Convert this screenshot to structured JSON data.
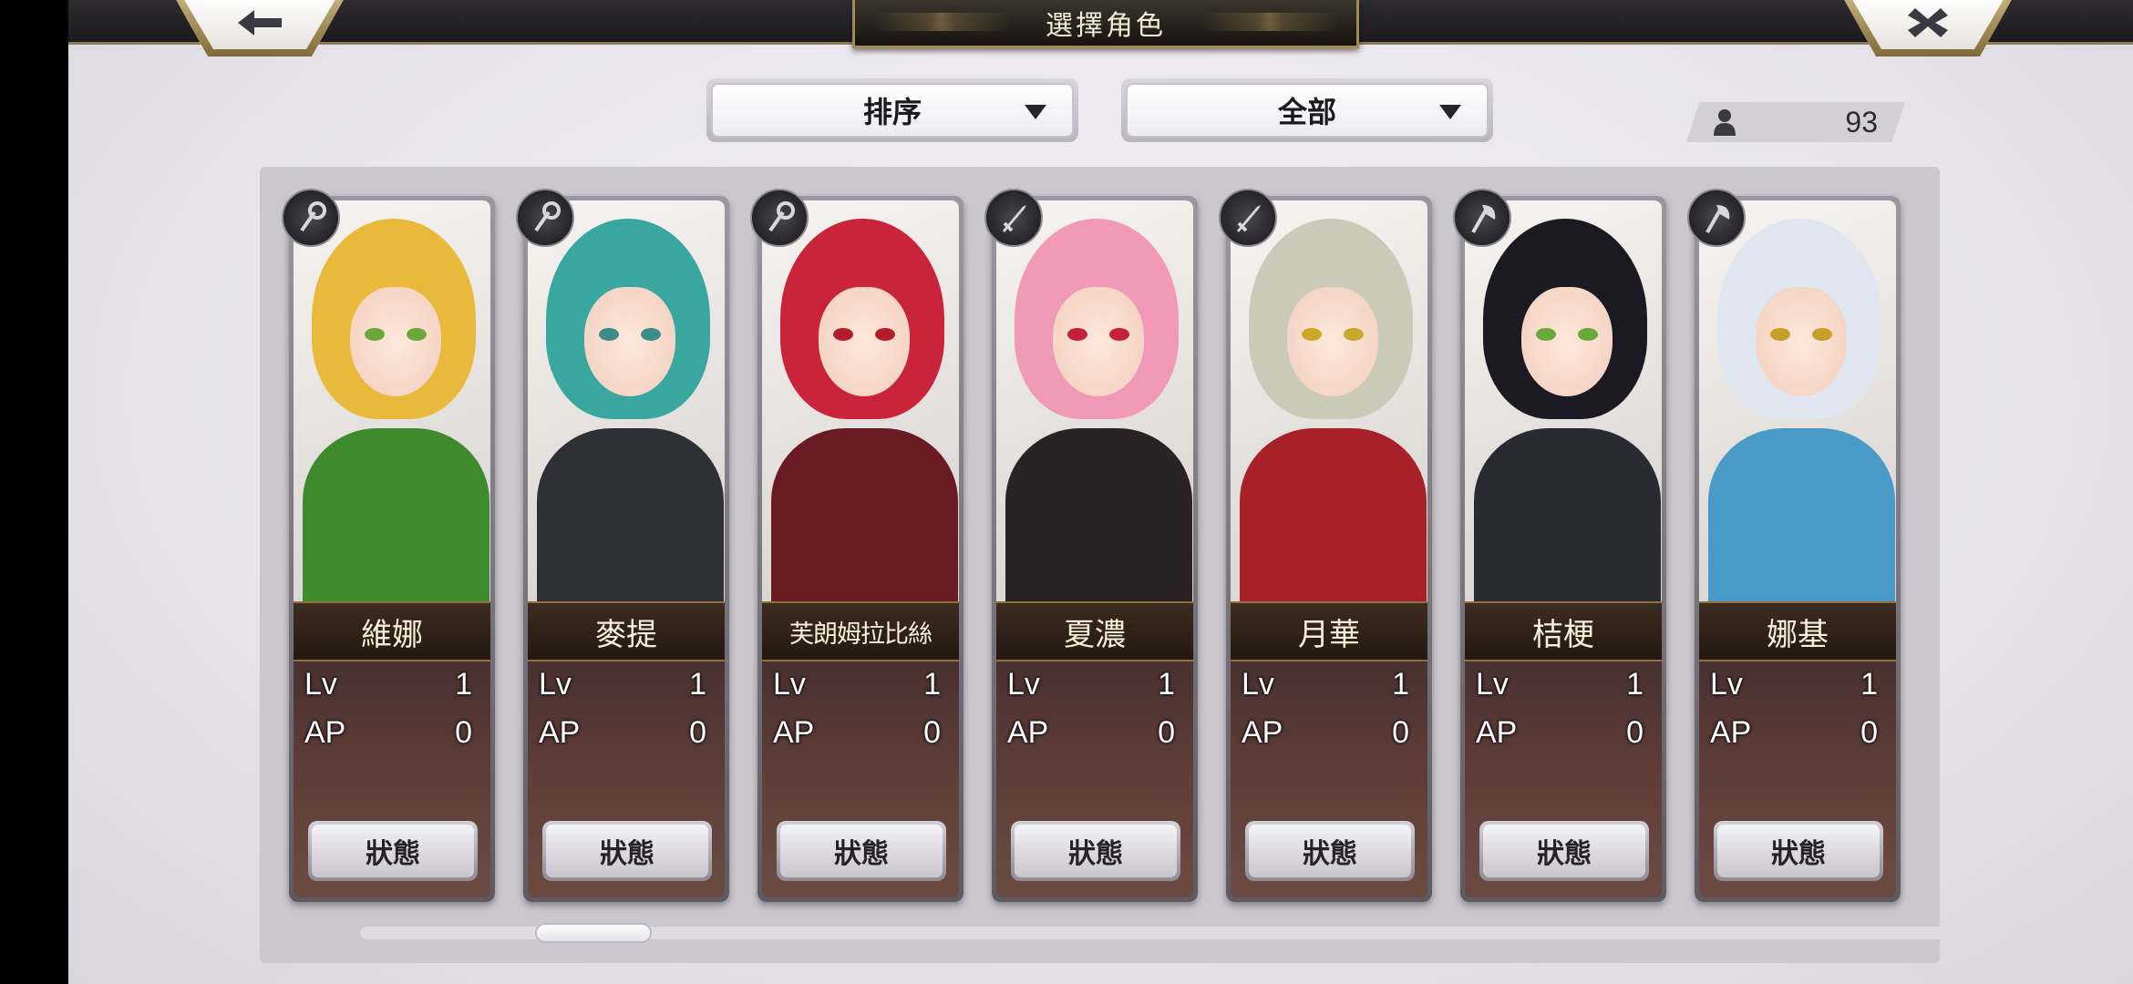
{
  "header": {
    "title": "選擇角色",
    "back_icon": "arrow-left-icon",
    "close_icon": "close-x-icon"
  },
  "filters": {
    "sort_label": "排序",
    "filter_label": "全部"
  },
  "character_count": "93",
  "status_label": "狀態",
  "lv_label": "Lv",
  "ap_label": "AP",
  "characters": [
    {
      "name": "維娜",
      "lv": "1",
      "ap": "0",
      "weapon": "staff-icon",
      "hair": "#e8b93a",
      "eyes": "#6aa83a",
      "outfit": "#3f8a2c"
    },
    {
      "name": "麥提",
      "lv": "1",
      "ap": "0",
      "weapon": "staff-icon",
      "hair": "#3aa6a0",
      "eyes": "#3c8c8a",
      "outfit": "#2f2f36"
    },
    {
      "name": "芙朗姆拉比絲",
      "lv": "1",
      "ap": "0",
      "weapon": "staff-icon",
      "hair": "#c9243a",
      "eyes": "#b31d2a",
      "outfit": "#6a1a22"
    },
    {
      "name": "夏濃",
      "lv": "1",
      "ap": "0",
      "weapon": "sword-icon",
      "hair": "#f09ab8",
      "eyes": "#c4203a",
      "outfit": "#2a2224"
    },
    {
      "name": "月華",
      "lv": "1",
      "ap": "0",
      "weapon": "sword-icon",
      "hair": "#c9cbb8",
      "eyes": "#c7a82a",
      "outfit": "#a82028"
    },
    {
      "name": "桔梗",
      "lv": "1",
      "ap": "0",
      "weapon": "axe-icon",
      "hair": "#1b1a22",
      "eyes": "#6aa83a",
      "outfit": "#2a2a33"
    },
    {
      "name": "娜基",
      "lv": "1",
      "ap": "0",
      "weapon": "axe-icon",
      "hair": "#dfe6ef",
      "eyes": "#c4a02a",
      "outfit": "#4a9ac8"
    }
  ]
}
